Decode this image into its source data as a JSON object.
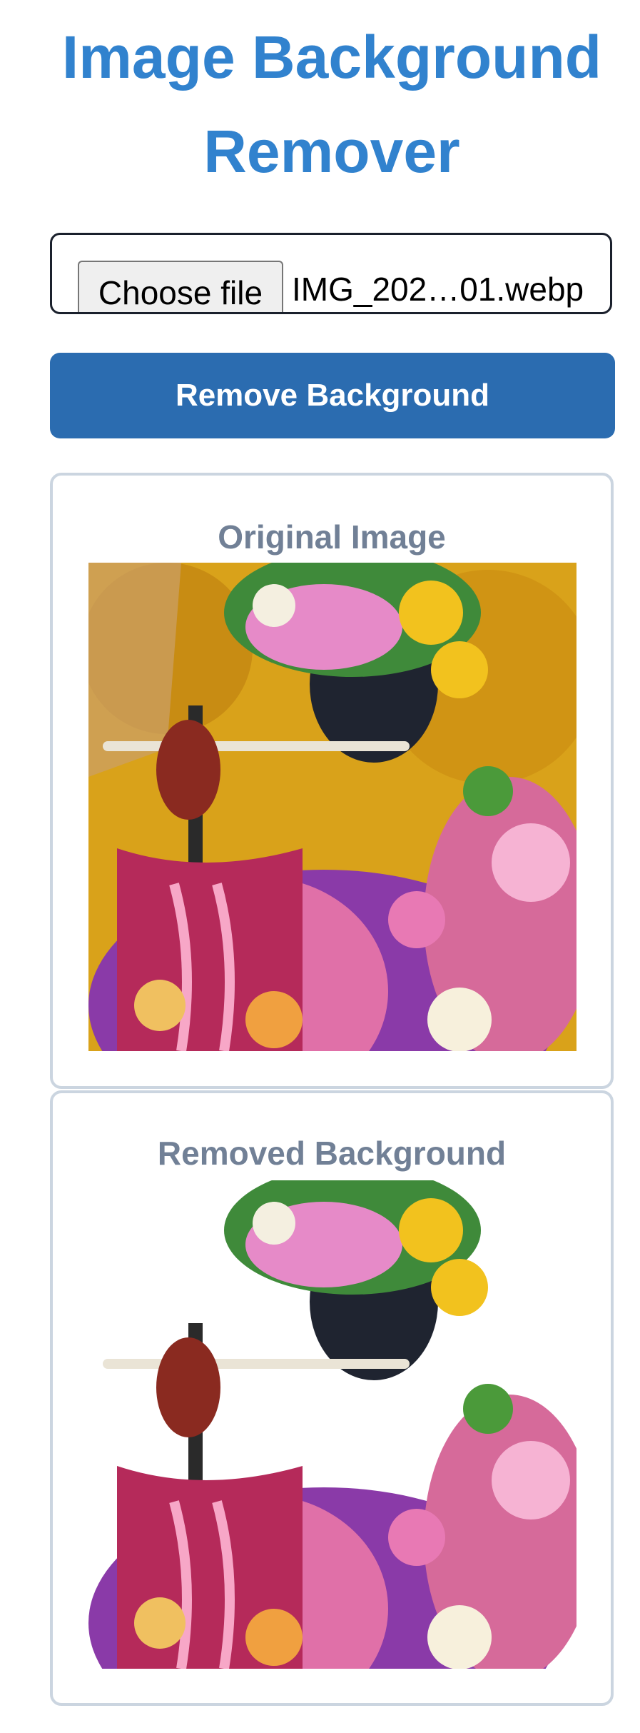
{
  "page": {
    "title": "Image Background Remover"
  },
  "upload": {
    "choose_label": "Choose file",
    "file_name": "IMG_202…01.webp"
  },
  "actions": {
    "remove_label": "Remove Background"
  },
  "original": {
    "heading": "Original Image"
  },
  "result": {
    "heading": "Removed Background"
  },
  "colors": {
    "title": "#3182ce",
    "button": "#2b6cb0",
    "card_border": "#cbd5e0",
    "heading": "#718096"
  }
}
